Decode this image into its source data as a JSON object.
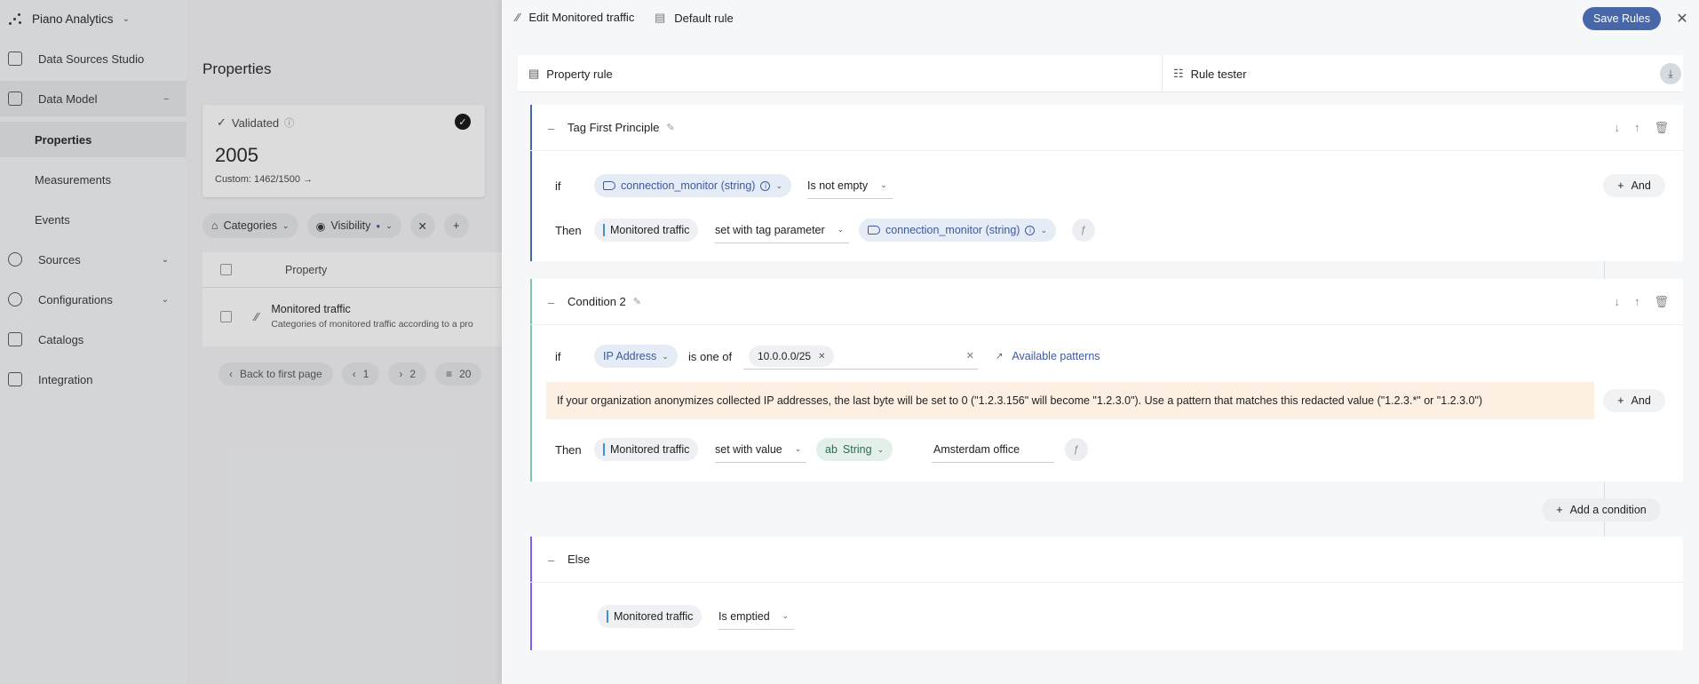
{
  "app": {
    "brand": "Piano Analytics",
    "nav": [
      {
        "label": "Data Sources Studio"
      },
      {
        "label": "Data Model"
      },
      {
        "label": "Sources"
      },
      {
        "label": "Configurations"
      },
      {
        "label": "Catalogs"
      },
      {
        "label": "Integration"
      }
    ],
    "subnav": [
      {
        "label": "Properties"
      },
      {
        "label": "Measurements"
      },
      {
        "label": "Events"
      }
    ]
  },
  "properties_page": {
    "title": "Properties",
    "kpi": {
      "status": "Validated",
      "value": "2005",
      "custom": "Custom: 1462/1500"
    },
    "filters": {
      "categories": "Categories",
      "visibility": "Visibility"
    },
    "table": {
      "header": "Property",
      "row": {
        "name": "Monitored traffic",
        "desc": "Categories of monitored traffic according to a pro"
      }
    },
    "pager": {
      "back": "Back to first page",
      "prev_page": "1",
      "next_page": "2",
      "per_page": "20"
    }
  },
  "drawer": {
    "edit_label": "Edit Monitored traffic",
    "rule_label": "Default rule",
    "save_label": "Save Rules",
    "tabs": {
      "property_rule": "Property rule",
      "rule_tester": "Rule tester"
    },
    "rule1": {
      "title": "Tag First Principle",
      "if": "if",
      "then": "Then",
      "cond_prop": "connection_monitor (string)",
      "operator": "Is not empty",
      "and": "And",
      "target": "Monitored traffic",
      "action": "set with tag parameter",
      "value_prop": "connection_monitor (string)"
    },
    "rule2": {
      "title": "Condition 2",
      "if": "if",
      "then": "Then",
      "cond_prop": "IP Address",
      "operator": "is one of",
      "chip": "10.0.0.0/25",
      "patterns": "Available patterns",
      "warning": "If your organization anonymizes collected IP addresses, the last byte will be set to 0 (\"1.2.3.156\" will become \"1.2.3.0\"). Use a pattern that matches this redacted value (\"1.2.3.*\" or \"1.2.3.0\")",
      "and": "And",
      "target": "Monitored traffic",
      "action": "set with value",
      "type_ab": "ab",
      "type": "String",
      "value": "Amsterdam office"
    },
    "add_condition": "Add a condition",
    "else": {
      "title": "Else",
      "target": "Monitored traffic",
      "action": "Is emptied"
    }
  },
  "colors": {
    "accent": "#4867a8",
    "rule_bar_1": "#4867a8",
    "rule_bar_2": "#7ec4a7",
    "else_bar": "#7b61ff",
    "warning_bg": "#fdf0e3"
  }
}
